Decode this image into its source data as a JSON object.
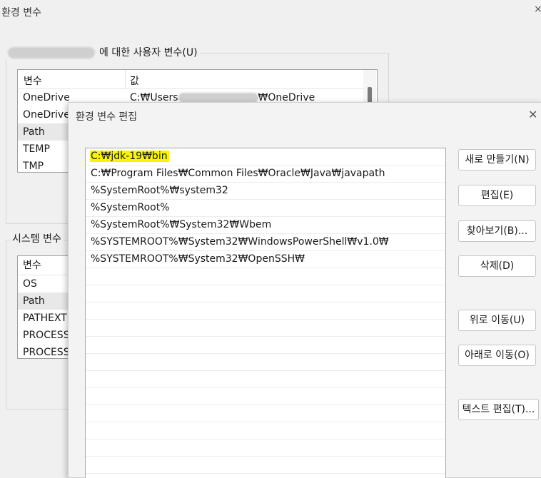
{
  "back_window": {
    "title": "환경 변수",
    "close": "×",
    "user_group_label": "에 대한 사용자 변수(U)",
    "user_list": {
      "col_var": "변수",
      "col_val": "값",
      "rows": [
        {
          "name": "OneDrive",
          "value_prefix": "C:₩Users",
          "value_suffix": "₩OneDrive"
        },
        {
          "name": "OneDrive",
          "value_prefix": "",
          "value_suffix": ""
        },
        {
          "name": "Path",
          "value_prefix": "",
          "value_suffix": ""
        },
        {
          "name": "TEMP",
          "value_prefix": "",
          "value_suffix": ""
        },
        {
          "name": "TMP",
          "value_prefix": "",
          "value_suffix": ""
        }
      ]
    },
    "system_group_label": "시스템 변수",
    "system_list": {
      "col_var": "변수",
      "rows": [
        "OS",
        "Path",
        "PATHEXT",
        "PROCESS",
        "PROCESS"
      ]
    }
  },
  "dialog": {
    "title": "환경 변수 편집",
    "close": "✕",
    "paths": [
      "C:₩jdk-19₩bin",
      "C:₩Program Files₩Common Files₩Oracle₩Java₩javapath",
      "%SystemRoot%₩system32",
      "%SystemRoot%",
      "%SystemRoot%₩System32₩Wbem",
      "%SYSTEMROOT%₩System32₩WindowsPowerShell₩v1.0₩",
      "%SYSTEMROOT%₩System32₩OpenSSH₩"
    ],
    "buttons": {
      "new": "새로 만들기(N)",
      "edit": "편집(E)",
      "browse": "찾아보기(B)...",
      "delete": "삭제(D)",
      "move_up": "위로 이동(U)",
      "move_down": "아래로 이동(O)",
      "edit_text": "텍스트 편집(T)..."
    }
  }
}
